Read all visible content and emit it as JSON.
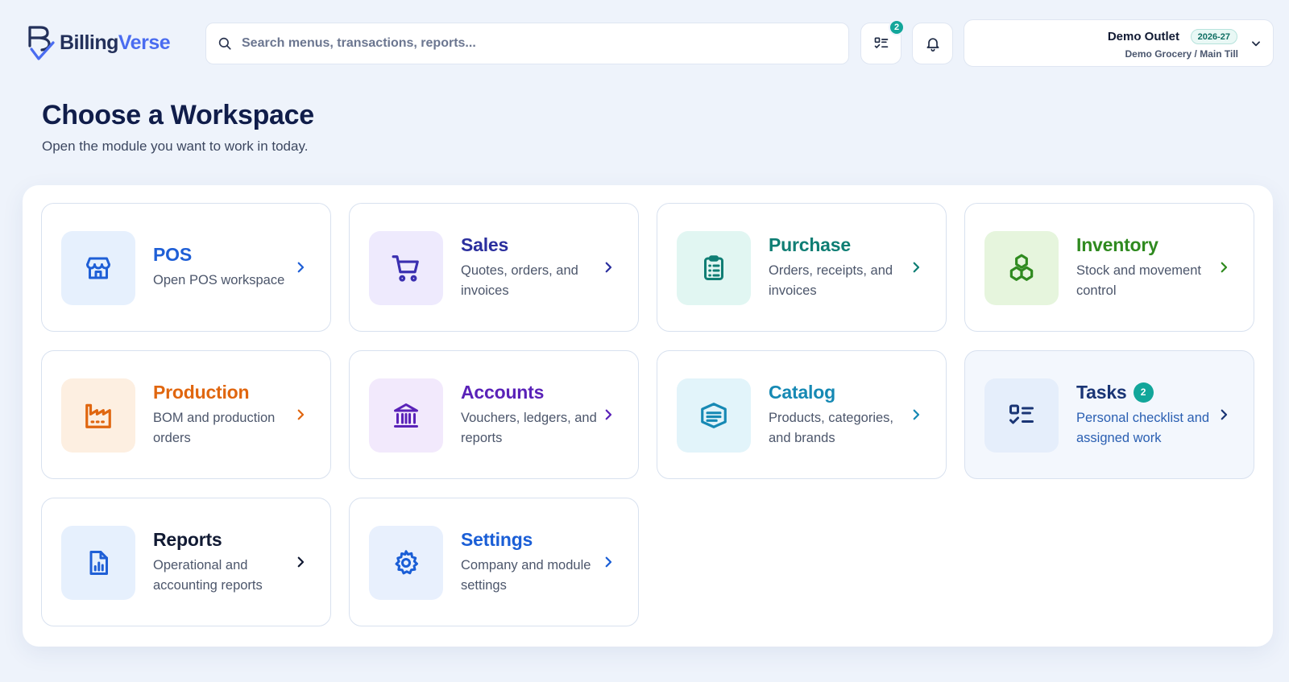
{
  "brand": {
    "name_part1": "Billing",
    "name_part2": "Verse"
  },
  "search": {
    "placeholder": "Search menus, transactions, reports..."
  },
  "header": {
    "tasks_badge_count": "2"
  },
  "outlet": {
    "name": "Demo Outlet",
    "year": "2026-27",
    "subtitle": "Demo Grocery / Main Till"
  },
  "page": {
    "title": "Choose a Workspace",
    "subtitle": "Open the module you want to work in today."
  },
  "workspaces": [
    {
      "title": "POS",
      "description": "Open POS workspace",
      "icon": "store-icon",
      "color": "#1f5fd6",
      "bg": "#e6f0fd"
    },
    {
      "title": "Sales",
      "description": "Quotes, orders, and invoices",
      "icon": "cart-icon",
      "color": "#2b2f9e",
      "bg": "#eeeafd"
    },
    {
      "title": "Purchase",
      "description": "Orders, receipts, and invoices",
      "icon": "clipboard-icon",
      "color": "#0f7e74",
      "bg": "#e1f6f2"
    },
    {
      "title": "Inventory",
      "description": "Stock and movement control",
      "icon": "boxes-icon",
      "color": "#2f8a1f",
      "bg": "#e6f5dd"
    },
    {
      "title": "Production",
      "description": "BOM and production orders",
      "icon": "factory-icon",
      "color": "#e0660f",
      "bg": "#fdefe1"
    },
    {
      "title": "Accounts",
      "description": "Vouchers, ledgers, and reports",
      "icon": "bank-icon",
      "color": "#5a22b8",
      "bg": "#f2e9fc"
    },
    {
      "title": "Catalog",
      "description": "Products, categories, and brands",
      "icon": "catalog-icon",
      "color": "#1689b4",
      "bg": "#e2f4fa"
    },
    {
      "title": "Tasks",
      "description": "Personal checklist and assigned work",
      "icon": "checklist-icon",
      "color": "#1a3575",
      "desc_color": "#2a5fb2",
      "bg": "#e5eefb",
      "badge": "2"
    },
    {
      "title": "Reports",
      "description": "Operational and accounting reports",
      "icon": "report-icon",
      "color": "#111a33",
      "bg": "#e6f0fd"
    },
    {
      "title": "Settings",
      "description": "Company and module settings",
      "icon": "gear-icon",
      "color": "#1a5ed6",
      "bg": "#e8f0fd"
    }
  ]
}
